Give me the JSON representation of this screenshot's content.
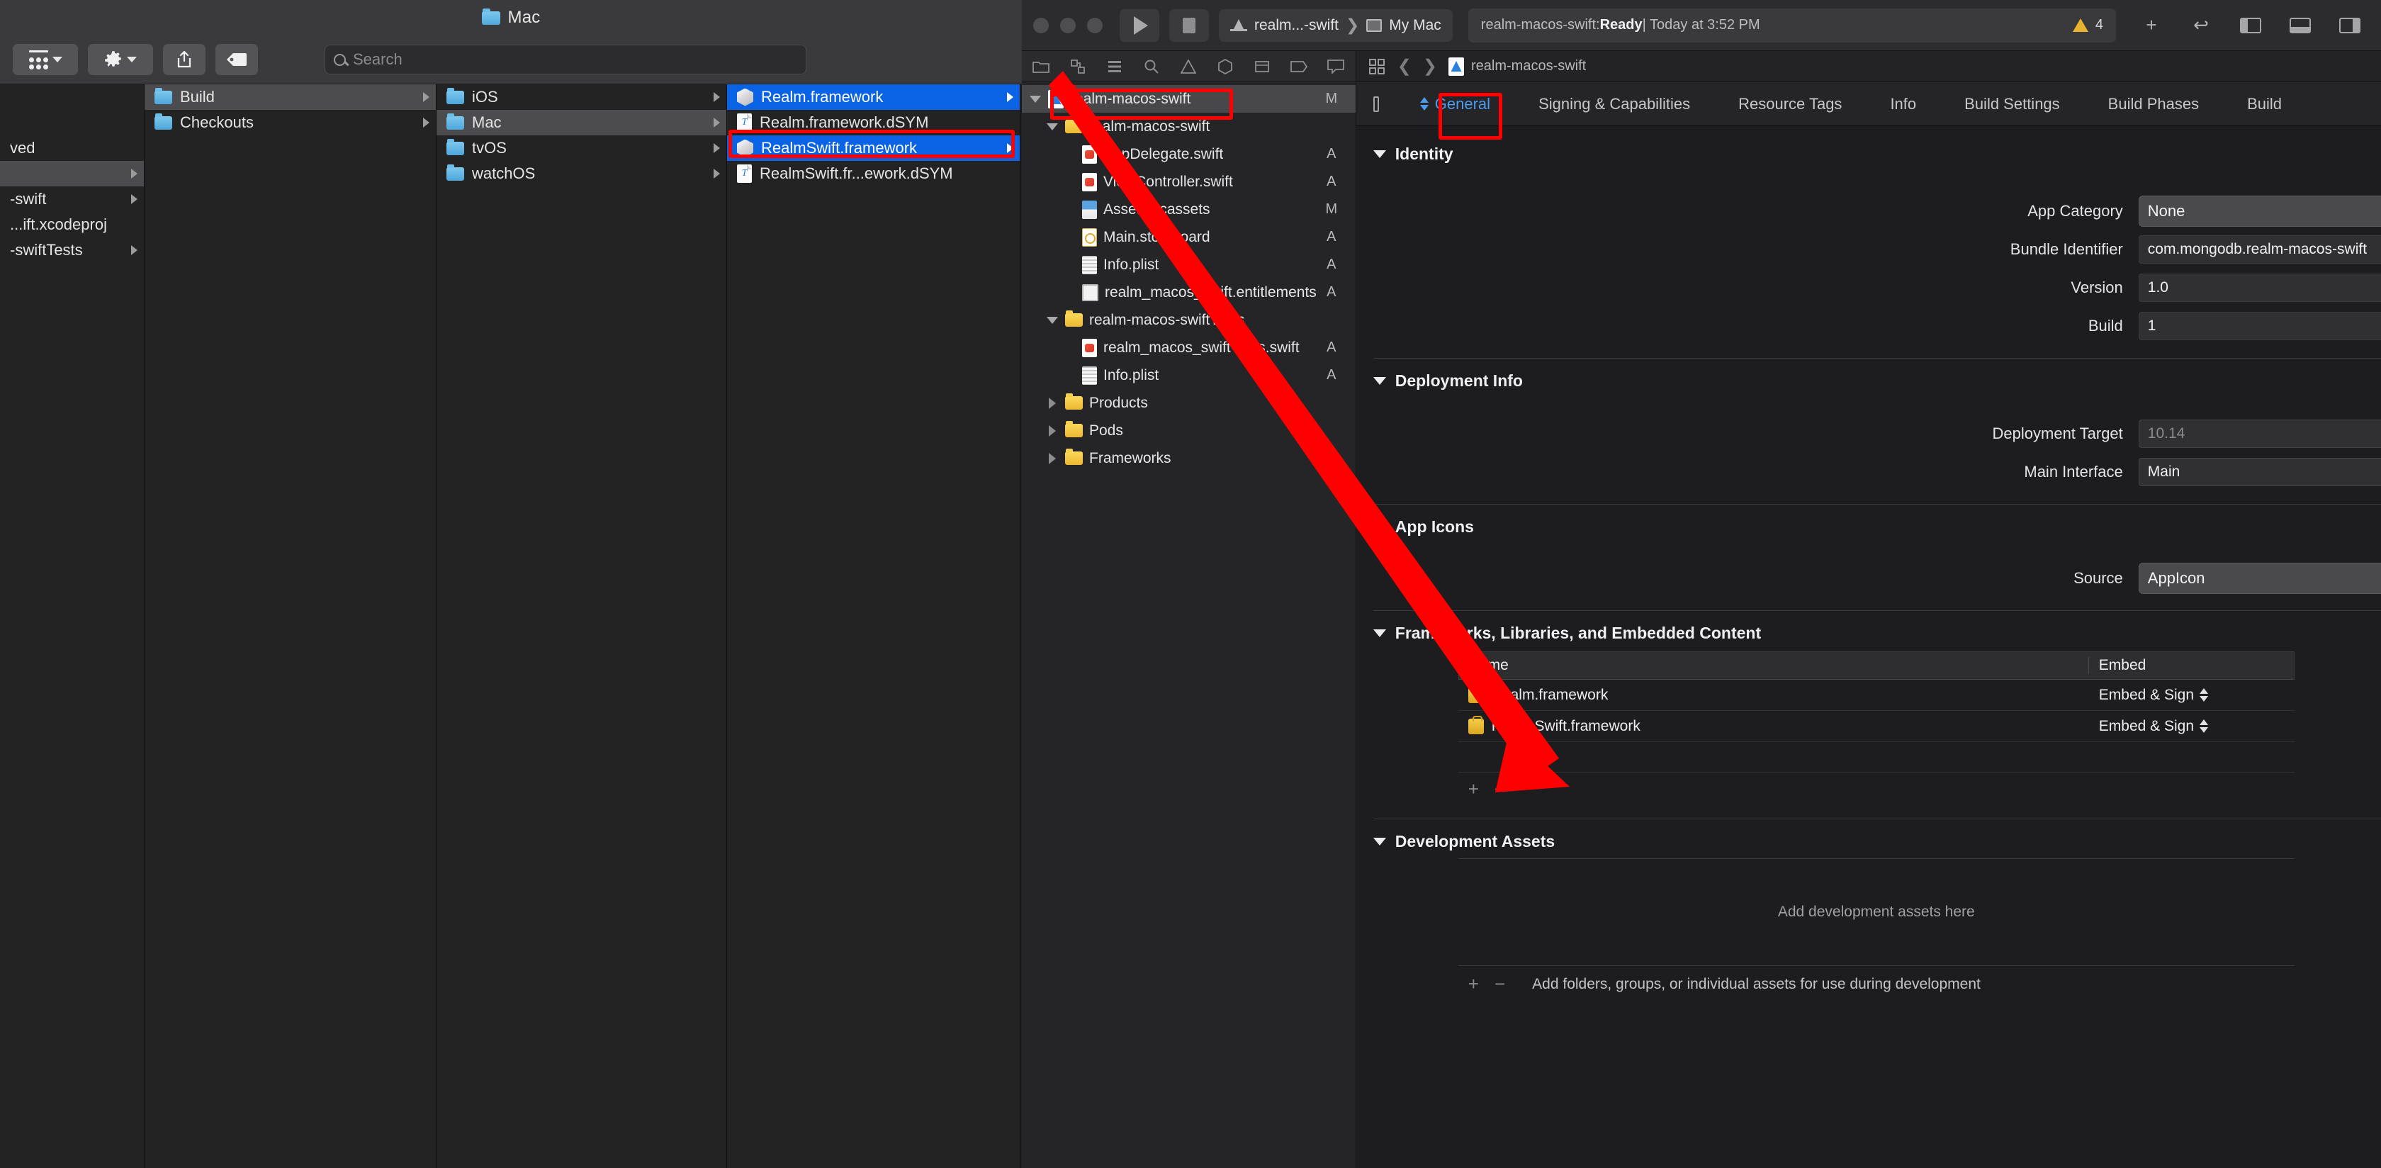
{
  "finder": {
    "title": "Mac",
    "toolbar": {
      "view_label": "grid-view-button",
      "action_label": "action-gear-button",
      "share_label": "share-button",
      "tags_label": "tags-button"
    },
    "search": {
      "placeholder": "Search",
      "value": ""
    },
    "columns": [
      {
        "name": "column-derived-data",
        "items": [
          {
            "label": "ved",
            "arrow": false,
            "selected": "none",
            "icon": "none",
            "blank_before": 1
          },
          {
            "label": "",
            "arrow": true,
            "selected": "grey",
            "icon": "none"
          },
          {
            "label": "-swift",
            "arrow": true,
            "selected": "none",
            "icon": "none"
          },
          {
            "label": "...ift.xcodeproj",
            "arrow": false,
            "selected": "none",
            "icon": "none"
          },
          {
            "label": "-swiftTests",
            "arrow": true,
            "selected": "none",
            "icon": "none"
          }
        ]
      },
      {
        "name": "column-build",
        "items": [
          {
            "label": "Build",
            "arrow": true,
            "selected": "grey",
            "icon": "folder"
          },
          {
            "label": "Checkouts",
            "arrow": true,
            "selected": "none",
            "icon": "folder"
          }
        ]
      },
      {
        "name": "column-platforms",
        "items": [
          {
            "label": "iOS",
            "arrow": true,
            "selected": "none",
            "icon": "folder"
          },
          {
            "label": "Mac",
            "arrow": true,
            "selected": "grey",
            "icon": "folder"
          },
          {
            "label": "tvOS",
            "arrow": true,
            "selected": "none",
            "icon": "folder"
          },
          {
            "label": "watchOS",
            "arrow": true,
            "selected": "none",
            "icon": "folder"
          }
        ]
      },
      {
        "name": "column-frameworks",
        "items": [
          {
            "label": "Realm.framework",
            "arrow": true,
            "selected": "blue",
            "icon": "framework"
          },
          {
            "label": "Realm.framework.dSYM",
            "arrow": false,
            "selected": "none",
            "icon": "dsym"
          },
          {
            "label": "RealmSwift.framework",
            "arrow": true,
            "selected": "blue",
            "icon": "framework"
          },
          {
            "label": "RealmSwift.fr...ework.dSYM",
            "arrow": false,
            "selected": "none",
            "icon": "dsym"
          }
        ]
      }
    ]
  },
  "xcode": {
    "toolbar": {
      "run_label": "run-button",
      "stop_label": "stop-button",
      "scheme": "realm...-swift",
      "scheme_separator": "❯",
      "destination": "My Mac",
      "status_prefix": "realm-macos-swift: ",
      "status_state": "Ready",
      "status_suffix": " | Today at 3:52 PM",
      "warning_count": "4",
      "add_label": "+",
      "undo_label": "↩"
    },
    "navigator": {
      "tabs": [
        "folder-icon",
        "source-control-icon",
        "symbol-icon",
        "find-icon",
        "issue-icon",
        "test-icon",
        "debug-icon",
        "breakpoint-icon",
        "report-icon"
      ],
      "tree": [
        {
          "label": "realm-macos-swift",
          "status": "M",
          "indent": 0,
          "twisty": "down",
          "icon": "project",
          "selected": true
        },
        {
          "label": "realm-macos-swift",
          "status": "",
          "indent": 1,
          "twisty": "down",
          "icon": "group",
          "selected": false
        },
        {
          "label": "AppDelegate.swift",
          "status": "A",
          "indent": 2,
          "twisty": "none",
          "icon": "swift",
          "selected": false
        },
        {
          "label": "ViewController.swift",
          "status": "A",
          "indent": 2,
          "twisty": "none",
          "icon": "swift",
          "selected": false
        },
        {
          "label": "Assets.xcassets",
          "status": "M",
          "indent": 2,
          "twisty": "none",
          "icon": "asset",
          "selected": false
        },
        {
          "label": "Main.storyboard",
          "status": "A",
          "indent": 2,
          "twisty": "none",
          "icon": "storyboard",
          "selected": false
        },
        {
          "label": "Info.plist",
          "status": "A",
          "indent": 2,
          "twisty": "none",
          "icon": "plist",
          "selected": false
        },
        {
          "label": "realm_macos_swift.entitlements",
          "status": "A",
          "indent": 2,
          "twisty": "none",
          "icon": "entitlements",
          "selected": false
        },
        {
          "label": "realm-macos-swiftTests",
          "status": "",
          "indent": 1,
          "twisty": "down",
          "icon": "group",
          "selected": false
        },
        {
          "label": "realm_macos_swiftTests.swift",
          "status": "A",
          "indent": 2,
          "twisty": "none",
          "icon": "swift",
          "selected": false
        },
        {
          "label": "Info.plist",
          "status": "A",
          "indent": 2,
          "twisty": "none",
          "icon": "plist",
          "selected": false
        },
        {
          "label": "Products",
          "status": "",
          "indent": 1,
          "twisty": "right",
          "icon": "group",
          "selected": false
        },
        {
          "label": "Pods",
          "status": "",
          "indent": 1,
          "twisty": "right",
          "icon": "group",
          "selected": false
        },
        {
          "label": "Frameworks",
          "status": "",
          "indent": 1,
          "twisty": "right",
          "icon": "group",
          "selected": false
        }
      ]
    },
    "jump_bar": {
      "path": "realm-macos-swift"
    },
    "tabs": [
      {
        "label": "General",
        "active": true
      },
      {
        "label": "Signing & Capabilities",
        "active": false
      },
      {
        "label": "Resource Tags",
        "active": false
      },
      {
        "label": "Info",
        "active": false
      },
      {
        "label": "Build Settings",
        "active": false
      },
      {
        "label": "Build Phases",
        "active": false
      },
      {
        "label": "Build",
        "active": false
      }
    ],
    "sections": {
      "identity": {
        "title": "Identity",
        "fields": [
          {
            "label": "App Category",
            "value": "None",
            "kind": "popup"
          },
          {
            "label": "Bundle Identifier",
            "value": "com.mongodb.realm-macos-swift",
            "kind": "text"
          },
          {
            "label": "Version",
            "value": "1.0",
            "kind": "text"
          },
          {
            "label": "Build",
            "value": "1",
            "kind": "text"
          }
        ]
      },
      "deployment": {
        "title": "Deployment Info",
        "fields": [
          {
            "label": "Deployment Target",
            "value": "10.14",
            "kind": "combo-dim"
          },
          {
            "label": "Main Interface",
            "value": "Main",
            "kind": "combo"
          }
        ]
      },
      "app_icons": {
        "title": "App Icons",
        "fields": [
          {
            "label": "Source",
            "value": "AppIcon",
            "kind": "popup"
          }
        ]
      },
      "frameworks": {
        "title": "Frameworks, Libraries, and Embedded Content",
        "columns": [
          "Name",
          "Embed"
        ],
        "rows": [
          {
            "name": "Realm.framework",
            "embed": "Embed & Sign"
          },
          {
            "name": "RealmSwift.framework",
            "embed": "Embed & Sign"
          }
        ],
        "add_label": "+",
        "remove_label": "−"
      },
      "development_assets": {
        "title": "Development Assets",
        "empty_text": "Add development assets here",
        "hint": "Add folders, groups, or individual assets for use during development",
        "add_label": "+",
        "remove_label": "−"
      }
    }
  },
  "annotations": {
    "arrow_color": "#ff0000",
    "boxes": [
      "finder-realmswift-row",
      "xcode-project-row",
      "xcode-general-tab"
    ]
  }
}
